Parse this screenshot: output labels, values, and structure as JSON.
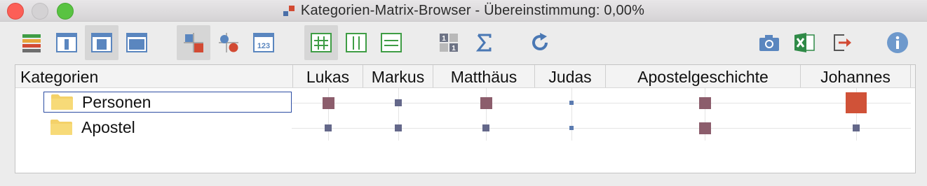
{
  "window": {
    "title": "Kategorien-Matrix-Browser - Übereinstimmung: 0,00%"
  },
  "toolbar": {
    "left_buttons": [
      {
        "icon": "color-bars-icon",
        "active": false
      },
      {
        "icon": "layout-single-column-icon",
        "active": false
      },
      {
        "icon": "layout-center-column-icon",
        "active": true
      },
      {
        "icon": "layout-full-icon",
        "active": false
      },
      {
        "icon": "squares-symbols-icon",
        "active": true
      },
      {
        "icon": "circles-symbols-icon",
        "active": false
      },
      {
        "icon": "numbers-icon",
        "active": false
      },
      {
        "icon": "grid-hash-icon",
        "active": true
      },
      {
        "icon": "columns-icon",
        "active": false
      },
      {
        "icon": "rows-icon",
        "active": false
      },
      {
        "icon": "binary-matrix-icon",
        "active": false
      },
      {
        "icon": "sigma-icon",
        "active": false
      },
      {
        "icon": "refresh-icon",
        "active": false
      }
    ],
    "right_buttons": [
      {
        "icon": "camera-icon"
      },
      {
        "icon": "excel-export-icon"
      },
      {
        "icon": "export-icon"
      },
      {
        "icon": "info-icon"
      }
    ]
  },
  "matrix": {
    "row_header_label": "Kategorien",
    "columns": [
      "Lukas",
      "Markus",
      "Matthäus",
      "Judas",
      "Apostelgeschichte",
      "Johannes"
    ],
    "rows": [
      {
        "label": "Personen",
        "selected": true,
        "cells": [
          "medium",
          "small",
          "medium",
          "tiny",
          "medium",
          "large"
        ]
      },
      {
        "label": "Apostel",
        "selected": false,
        "cells": [
          "small",
          "small",
          "small",
          "tiny",
          "medium",
          "small"
        ]
      }
    ],
    "colors": {
      "tiny": "#5b7bb0",
      "small": "#64688a",
      "medium": "#8c5d6c",
      "large": "#d05238"
    }
  }
}
